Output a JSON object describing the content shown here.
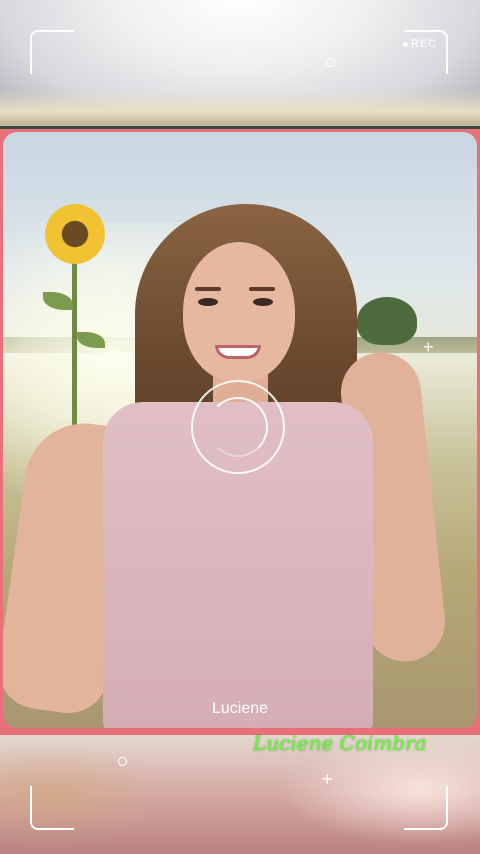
{
  "viewfinder": {
    "record_label": "REC",
    "caption_name": "Luciene",
    "signature": "Luciene Coimbra"
  },
  "colors": {
    "frame": "#e8707b",
    "signature": "#5dff2e",
    "overlay": "#ffffff"
  },
  "icons": [
    "record-dot-icon",
    "focus-ring-icon",
    "circle-marker-icon",
    "plus-marker-icon"
  ]
}
